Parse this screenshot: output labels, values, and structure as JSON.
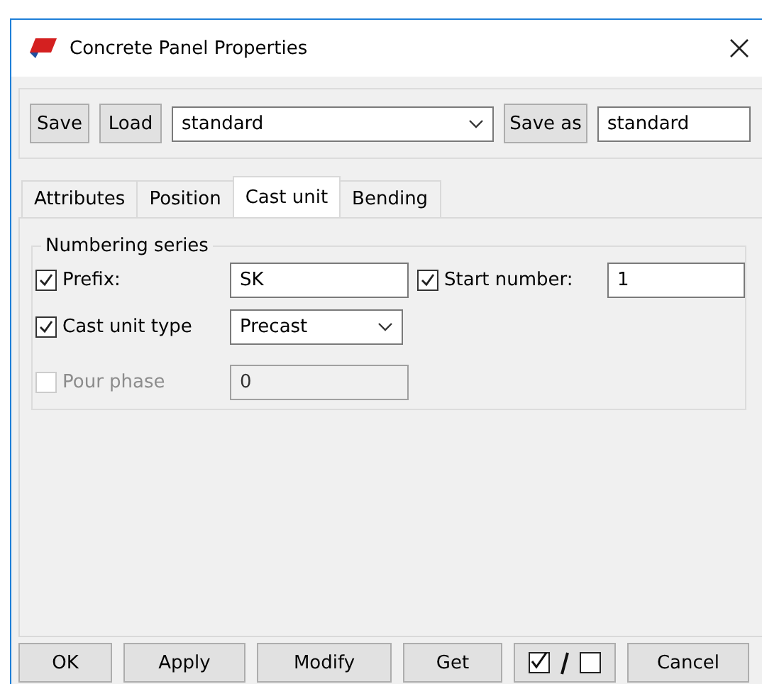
{
  "window": {
    "title": "Concrete Panel Properties"
  },
  "toolbar": {
    "save": "Save",
    "load": "Load",
    "preset": "standard",
    "save_as": "Save as",
    "save_as_name": "standard"
  },
  "tabs": [
    {
      "label": "Attributes",
      "selected": false
    },
    {
      "label": "Position",
      "selected": false
    },
    {
      "label": "Cast unit",
      "selected": true
    },
    {
      "label": "Bending",
      "selected": false
    }
  ],
  "group": {
    "title": "Numbering series",
    "prefix": {
      "label": "Prefix:",
      "checked": true,
      "value": "SK"
    },
    "start_number": {
      "label": "Start number:",
      "checked": true,
      "value": "1"
    },
    "cast_unit_type": {
      "label": "Cast unit type",
      "checked": true,
      "value": "Precast"
    },
    "pour_phase": {
      "label": "Pour phase",
      "checked": false,
      "disabled": true,
      "value": "0"
    }
  },
  "buttons": [
    {
      "kind": "text",
      "label": "OK"
    },
    {
      "kind": "text",
      "label": "Apply"
    },
    {
      "kind": "text",
      "label": "Modify"
    },
    {
      "kind": "text",
      "label": "Get"
    },
    {
      "kind": "toggle"
    },
    {
      "kind": "text",
      "label": "Cancel"
    }
  ]
}
